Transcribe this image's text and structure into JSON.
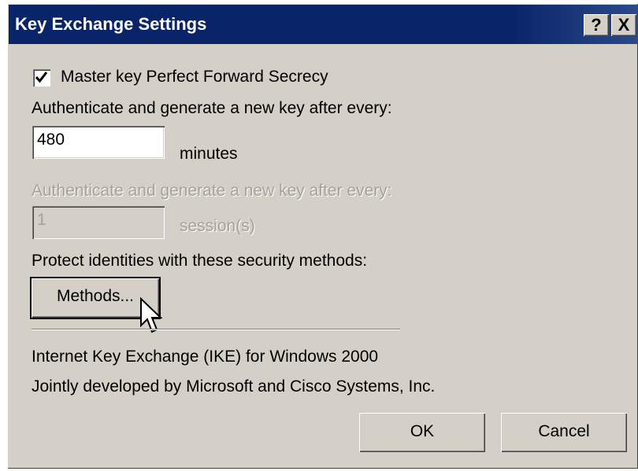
{
  "dialog": {
    "title": "Key Exchange Settings",
    "help_label": "?",
    "close_label": "X"
  },
  "pfs": {
    "checked": true,
    "label": "Master key Perfect Forward Secrecy"
  },
  "minutes_section": {
    "label": "Authenticate and generate a new key after every:",
    "value": "480",
    "unit": "minutes"
  },
  "sessions_section": {
    "label": "Authenticate and generate a new key after every:",
    "value": "1",
    "unit": "session(s)",
    "enabled": false
  },
  "methods_section": {
    "label": "Protect identities with these security methods:",
    "button_label": "Methods..."
  },
  "footer": {
    "line1": "Internet Key Exchange (IKE) for Windows 2000",
    "line2": "Jointly developed by Microsoft and Cisco Systems, Inc."
  },
  "buttons": {
    "ok": "OK",
    "cancel": "Cancel"
  },
  "icons": {
    "checkmark": "check-icon",
    "cursor": "mouse-pointer-icon"
  }
}
